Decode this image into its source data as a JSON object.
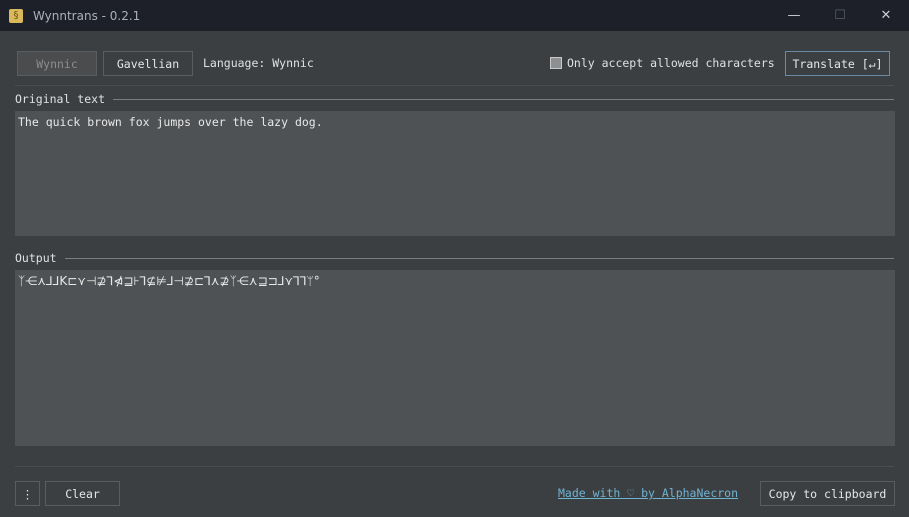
{
  "window": {
    "title": "Wynntrans - 0.2.1",
    "minimize": "—",
    "maximize": "☐",
    "close": "✕"
  },
  "toolbar": {
    "wynnic_label": "Wynnic",
    "gavellian_label": "Gavellian",
    "language_text": "Language: Wynnic",
    "checkbox_label": "Only accept allowed characters",
    "checkbox_checked": false,
    "translate_label": "Translate [↵]"
  },
  "original": {
    "heading": "Original text",
    "value": "The quick brown fox jumps over the lazy dog."
  },
  "output": {
    "heading": "Output",
    "value": "ᛉ⋲⋏⅃⅃K⊏⋎⊣⊉⅂⋪⊒⊦⅂⊈⊭⅃⊣⊉⊏⅂⋏⊉ᛉ⋲⋏⊒⊐⅃⋎⅂⅂ᛘ°"
  },
  "footer": {
    "menu_label": "⋮",
    "clear_label": "Clear",
    "credit_link": "Made with ♡ by AlphaNecron",
    "copy_label": "Copy to clipboard"
  }
}
